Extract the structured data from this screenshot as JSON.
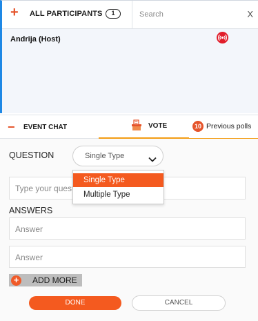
{
  "participants": {
    "add_symbol": "+",
    "title": "ALL PARTICIPANTS",
    "count": "1",
    "search_placeholder": "Search",
    "close_symbol": "X",
    "host": {
      "name": "Andrija (Host)",
      "status_icon": "broadcast-icon"
    }
  },
  "tabs": {
    "chat": {
      "collapse_symbol": "−",
      "label": "EVENT CHAT"
    },
    "vote": {
      "label": "VOTE",
      "icon": "ballot-box-icon"
    },
    "previous": {
      "count": "10",
      "label": "Previous polls"
    }
  },
  "form": {
    "question_label": "QUESTION",
    "type_select": {
      "value": "Single Type",
      "options": [
        "Single Type",
        "Multiple Type"
      ],
      "highlighted": "Single Type"
    },
    "question_placeholder": "Type your question",
    "answers_label": "ANSWERS",
    "answer_placeholders": [
      "Answer",
      "Answer"
    ],
    "add_more_label": "ADD MORE",
    "add_more_symbol": "+",
    "done_label": "DONE",
    "cancel_label": "CANCEL"
  },
  "colors": {
    "accent_orange": "#f45a1f",
    "tab_underline": "#f39c12",
    "participant_border": "#1e88e5",
    "live_red": "#e11d2a"
  }
}
